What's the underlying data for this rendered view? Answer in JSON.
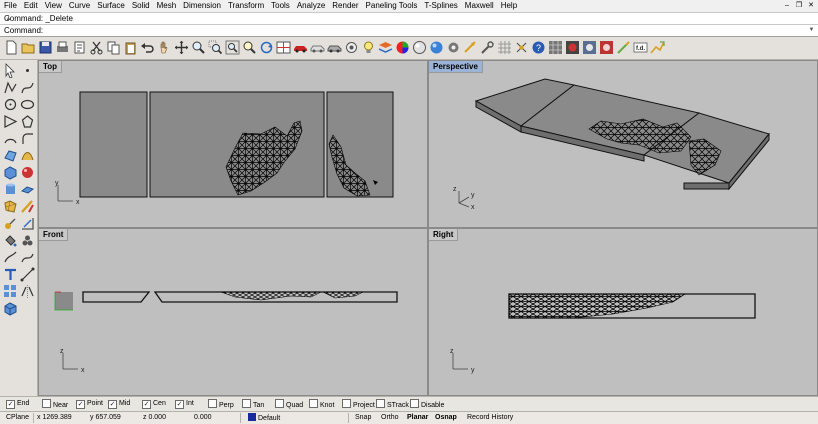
{
  "menu": {
    "items": [
      "File",
      "Edit",
      "View",
      "Curve",
      "Surface",
      "Solid",
      "Mesh",
      "Dimension",
      "Transform",
      "Tools",
      "Analyze",
      "Render",
      "Paneling Tools",
      "T-Splines",
      "Maxwell",
      "Help"
    ]
  },
  "command_history": {
    "text": "Command: _Delete"
  },
  "command_prompt": {
    "label": "Command:",
    "value": ""
  },
  "viewports": {
    "top": {
      "label": "Top",
      "axis_x": "x",
      "axis_y": "y"
    },
    "perspective": {
      "label": "Perspective",
      "axis_x": "x",
      "axis_y": "y",
      "axis_z": "z"
    },
    "front": {
      "label": "Front",
      "axis_x": "x",
      "axis_z": "z"
    },
    "right": {
      "label": "Right",
      "axis_y": "y",
      "axis_z": "z"
    }
  },
  "osnap": {
    "items": [
      {
        "label": "End",
        "checked": true
      },
      {
        "label": "Near",
        "checked": false
      },
      {
        "label": "Point",
        "checked": true
      },
      {
        "label": "Mid",
        "checked": true
      },
      {
        "label": "Cen",
        "checked": true
      },
      {
        "label": "Int",
        "checked": true
      },
      {
        "label": "Perp",
        "checked": false
      },
      {
        "label": "Tan",
        "checked": false
      },
      {
        "label": "Quad",
        "checked": false
      },
      {
        "label": "Knot",
        "checked": false
      },
      {
        "label": "Project",
        "checked": false
      },
      {
        "label": "STrack",
        "checked": false
      },
      {
        "label": "Disable",
        "checked": false
      }
    ]
  },
  "status": {
    "cplane": "CPlane",
    "x": "x 1269.389",
    "y": "y 657.059",
    "z": "z 0.000",
    "distance": "0.000",
    "layer": "Default",
    "layer_color": "#1a2a9a",
    "snap": "Snap",
    "ortho": "Ortho",
    "planar": "Planar",
    "osnap": "Osnap",
    "record_history": "Record History"
  },
  "colors": {
    "viewport_bg": "#bfbfbf",
    "active_label": "#9ab3d6",
    "object_fill": "#8a8a8a"
  }
}
